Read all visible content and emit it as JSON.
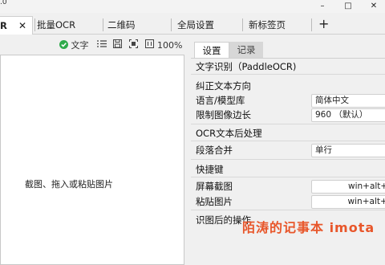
{
  "titlebar": {
    "version": ".0",
    "minimize": "–",
    "maximize": "□",
    "close": "✕"
  },
  "tabs": [
    {
      "label": "R",
      "close": "✕"
    },
    {
      "label": "批量OCR"
    },
    {
      "label": "二维码"
    },
    {
      "label": "全局设置"
    },
    {
      "label": "新标签页"
    }
  ],
  "tab_add": "+",
  "toolbar": {
    "text_toggle": "文字",
    "zoom": "100%"
  },
  "canvas": {
    "hint": "截图、拖入或粘贴图片"
  },
  "settings": {
    "tabs": [
      "设置",
      "记录"
    ],
    "sections": {
      "ocr": "文字识别（PaddleOCR)",
      "correct": "纠正文本方向",
      "post": "OCR文本后处理",
      "hotkeys": "快捷键",
      "after": "识图后的操作"
    },
    "rows": {
      "language": {
        "label": "语言/模型库",
        "value": "简体中文"
      },
      "limit": {
        "label": "限制图像边长",
        "value": "960 （默认）"
      },
      "merge": {
        "label": "段落合并",
        "value": "单行"
      },
      "screenshot": {
        "label": "屏幕截图",
        "value": "win+alt+c"
      },
      "paste": {
        "label": "粘贴图片",
        "value": "win+alt+v"
      }
    }
  },
  "watermark": "陌涛的记事本 imota"
}
